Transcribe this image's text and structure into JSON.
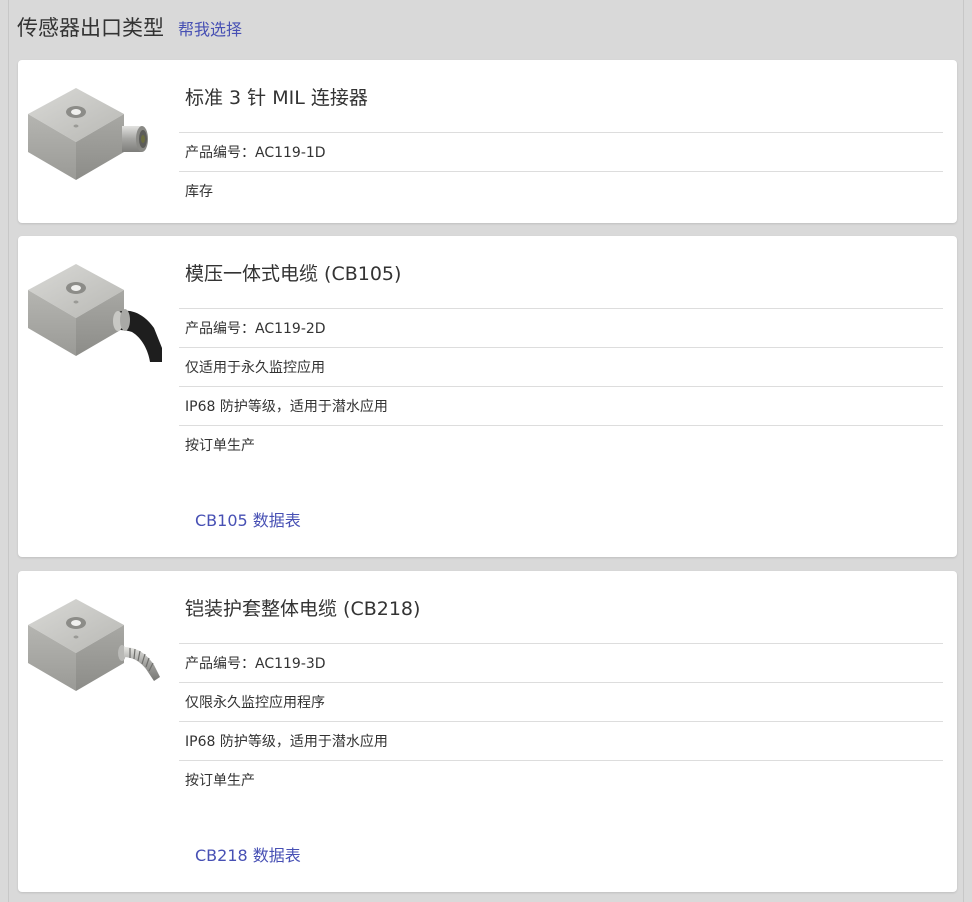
{
  "header": {
    "title": "传感器出口类型",
    "help_link": "帮我选择"
  },
  "options": [
    {
      "title": "标准 3 针 MIL 连接器",
      "part_number": "产品编号：AC119-1D",
      "details": [
        "库存"
      ],
      "connector": "mil-connector"
    },
    {
      "title": "模压一体式电缆 (CB105)",
      "part_number": "产品编号：AC119-2D",
      "details": [
        "仅适用于永久监控应用",
        "IP68 防护等级，适用于潜水应用",
        "按订单生产"
      ],
      "datasheet_link": "CB105 数据表",
      "connector": "molded-cable"
    },
    {
      "title": "铠装护套整体电缆 (CB218)",
      "part_number": "产品编号：AC119-3D",
      "details": [
        "仅限永久监控应用程序",
        "IP68 防护等级，适用于潜水应用",
        "按订单生产"
      ],
      "datasheet_link": "CB218 数据表",
      "connector": "armored-cable"
    }
  ],
  "colors": {
    "link": "#4750b4",
    "background": "#d9d9d9",
    "card": "#ffffff"
  }
}
